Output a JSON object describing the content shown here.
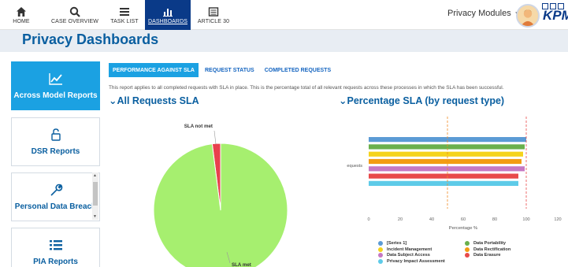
{
  "nav": {
    "home": "HOME",
    "case_overview": "CASE OVERVIEW",
    "task_list": "TASK LIST",
    "dashboards": "DASHBOARDS",
    "article30": "ARTICLE 30"
  },
  "header": {
    "modules_label": "Privacy Modules",
    "brand": "KPM",
    "page_title": "Privacy Dashboards"
  },
  "sidebar": {
    "items": [
      {
        "label": "Across Model Reports",
        "icon": "trend-chart-icon"
      },
      {
        "label": "DSR Reports",
        "icon": "unlock-icon"
      },
      {
        "label": "Personal Data Breach",
        "icon": "wrench-icon"
      },
      {
        "label": "PIA Reports",
        "icon": "list-icon"
      }
    ]
  },
  "tabs": [
    {
      "label": "PERFORMANCE AGAINST SLA",
      "active": true
    },
    {
      "label": "REQUEST STATUS",
      "active": false
    },
    {
      "label": "COMPLETED REQUESTS",
      "active": false
    }
  ],
  "note": "This report applies to all completed requests with SLA in place. This is the percentage total of all relevant requests across these processes in which the SLA has been successful.",
  "sections": {
    "all_requests": "All Requests SLA",
    "percentage": "Percentage SLA (by request type)"
  },
  "colors": {
    "brand_blue": "#0a3a88",
    "accent_cyan": "#1ba1e2",
    "sla_met": "#a6ef6f",
    "sla_not_met": "#e8414d"
  },
  "chart_data": [
    {
      "type": "pie",
      "title": "All Requests SLA",
      "labels": [
        "SLA not met",
        "SLA met"
      ],
      "values": [
        2,
        98
      ],
      "colors": [
        "#e8414d",
        "#a6ef6f"
      ]
    },
    {
      "type": "bar",
      "orientation": "horizontal",
      "title": "Percentage SLA (by request type)",
      "categories": [
        "Requests"
      ],
      "xlabel": "Percentage %",
      "ylabel": "",
      "xlim": [
        0,
        120
      ],
      "xticks": [
        "0",
        "20",
        "40",
        "60",
        "80",
        "100",
        "120"
      ],
      "reference_lines": [
        50,
        100
      ],
      "series": [
        {
          "name": "[Series 1]",
          "value": 100,
          "color": "#5b9bd5"
        },
        {
          "name": "Data Portability",
          "value": 99,
          "color": "#6ab04c"
        },
        {
          "name": "Incident Management",
          "value": 98,
          "color": "#f5d31c"
        },
        {
          "name": "Data Rectification",
          "value": 97,
          "color": "#f39c12"
        },
        {
          "name": "Data Subject Access",
          "value": 99,
          "color": "#c678c3"
        },
        {
          "name": "Data Erasure",
          "value": 95,
          "color": "#e84a4a"
        },
        {
          "name": "Privacy Impact Assessment",
          "value": 95,
          "color": "#5ecbe8"
        }
      ]
    }
  ]
}
